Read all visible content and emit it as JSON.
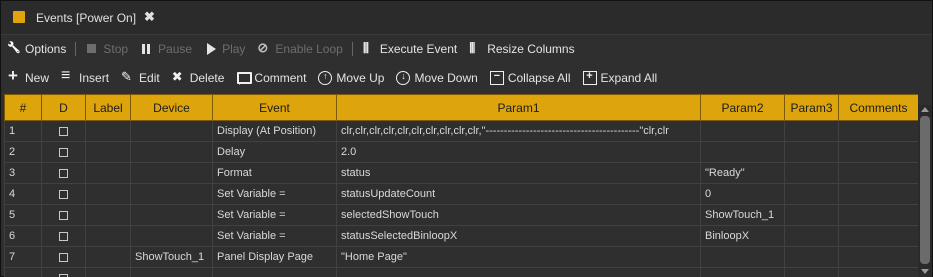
{
  "window": {
    "title": "Events [Power On]",
    "accent": "#dea40b"
  },
  "toolbar1": {
    "options": "Options",
    "stop": "Stop",
    "pause": "Pause",
    "play": "Play",
    "enable_loop": "Enable Loop",
    "execute_event": "Execute Event",
    "resize_columns": "Resize Columns"
  },
  "toolbar2": {
    "new": "New",
    "insert": "Insert",
    "edit": "Edit",
    "delete": "Delete",
    "comment": "Comment",
    "move_up": "Move Up",
    "move_down": "Move Down",
    "collapse_all": "Collapse All",
    "expand_all": "Expand All"
  },
  "table": {
    "headers": [
      "#",
      "D",
      "Label",
      "Device",
      "Event",
      "Param1",
      "Param2",
      "Param3",
      "Comments"
    ],
    "rows": [
      {
        "num": "1",
        "label": "",
        "device": "",
        "event": "Display (At Position)",
        "param1": "clr,clr,clr,clr,clr,clr,clr,clr,clr,clr,\"------------------------------------------\"clr,clr",
        "param2": "",
        "param3": "",
        "comments": ""
      },
      {
        "num": "2",
        "label": "",
        "device": "",
        "event": "Delay",
        "param1": "2.0",
        "param2": "",
        "param3": "",
        "comments": ""
      },
      {
        "num": "3",
        "label": "",
        "device": "",
        "event": "Format",
        "param1": "status",
        "param2": "\"Ready\"",
        "param3": "",
        "comments": ""
      },
      {
        "num": "4",
        "label": "",
        "device": "",
        "event": "Set Variable =",
        "param1": "statusUpdateCount",
        "param2": "0",
        "param3": "",
        "comments": ""
      },
      {
        "num": "5",
        "label": "",
        "device": "",
        "event": "Set Variable =",
        "param1": "selectedShowTouch",
        "param2": "ShowTouch_1",
        "param3": "",
        "comments": ""
      },
      {
        "num": "6",
        "label": "",
        "device": "",
        "event": "Set Variable =",
        "param1": "statusSelectedBinloopX",
        "param2": "BinloopX",
        "param3": "",
        "comments": ""
      },
      {
        "num": "7",
        "label": "",
        "device": "ShowTouch_1",
        "event": "Panel Display Page",
        "param1": "\"Home Page\"",
        "param2": "",
        "param3": "",
        "comments": ""
      },
      {
        "num": "",
        "label": "",
        "device": "",
        "event": "",
        "param1": "",
        "param2": "",
        "param3": "",
        "comments": ""
      }
    ]
  }
}
